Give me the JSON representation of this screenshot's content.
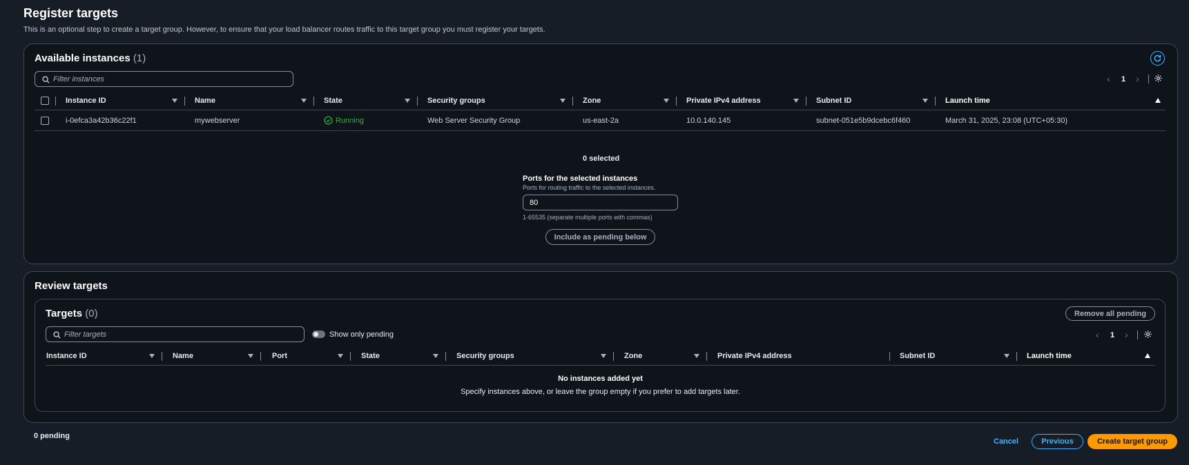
{
  "page": {
    "title": "Register targets",
    "description": "This is an optional step to create a target group. However, to ensure that your load balancer routes traffic to this target group you must register your targets."
  },
  "available": {
    "title": "Available instances",
    "count": "(1)",
    "search_placeholder": "Filter instances",
    "page_number": "1",
    "columns": [
      "Instance ID",
      "Name",
      "State",
      "Security groups",
      "Zone",
      "Private IPv4 address",
      "Subnet ID",
      "Launch time"
    ],
    "rows": [
      {
        "instance_id": "i-0efca3a42b36c22f1",
        "name": "mywebserver",
        "state": "Running",
        "security_groups": "Web Server Security Group",
        "zone": "us-east-2a",
        "ipv4": "10.0.140.145",
        "subnet_id": "subnet-051e5b9dcebc6f460",
        "launch_time": "March 31, 2025, 23:08 (UTC+05:30)"
      }
    ],
    "selected_text": "0 selected",
    "ports_label": "Ports for the selected instances",
    "ports_desc": "Ports for routing traffic to the selected instances.",
    "ports_value": "80",
    "ports_hint": "1-65535 (separate multiple ports with commas)",
    "include_button": "Include as pending below"
  },
  "review": {
    "title": "Review targets",
    "targets_title": "Targets",
    "targets_count": "(0)",
    "remove_all_button": "Remove all pending",
    "search_placeholder": "Filter targets",
    "show_only_pending": "Show only pending",
    "page_number": "1",
    "columns": [
      "Instance ID",
      "Name",
      "Port",
      "State",
      "Security groups",
      "Zone",
      "Private IPv4 address",
      "Subnet ID",
      "Launch time"
    ],
    "empty_title": "No instances added yet",
    "empty_desc": "Specify instances above, or leave the group empty if you prefer to add targets later."
  },
  "footer": {
    "pending": "0 pending",
    "cancel": "Cancel",
    "previous": "Previous",
    "create": "Create target group"
  },
  "colors": {
    "background": "#161d26",
    "panel": "#0f141a",
    "accent": "#42b4ff",
    "primary": "#ff9900",
    "success": "#2bb534"
  }
}
